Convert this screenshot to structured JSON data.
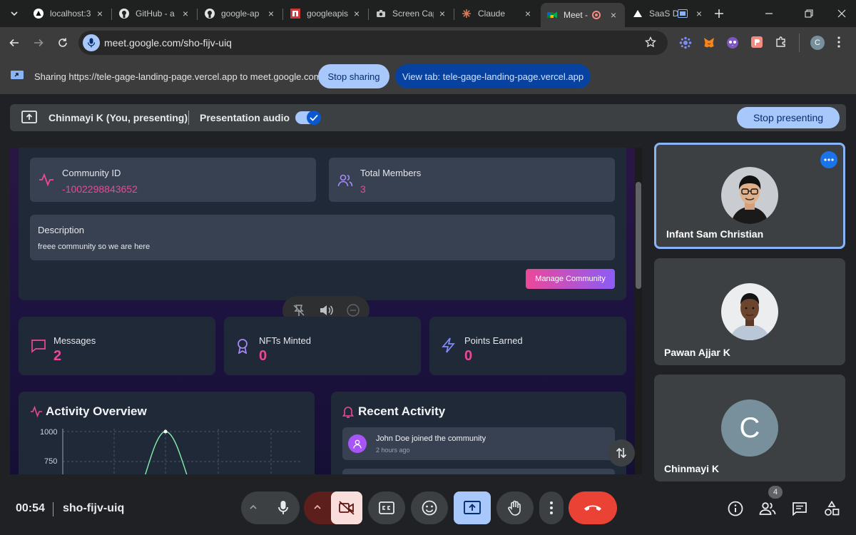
{
  "browser": {
    "tabs": [
      {
        "title": "localhost:3"
      },
      {
        "title": "GitHub - a"
      },
      {
        "title": "google-ap"
      },
      {
        "title": "googleapis"
      },
      {
        "title": "Screen Cap"
      },
      {
        "title": "Claude"
      },
      {
        "title": "Meet -"
      },
      {
        "title": "SaaS D"
      }
    ],
    "url": "meet.google.com/sho-fijv-uiq",
    "profile_initial": "C"
  },
  "sharing": {
    "message": "Sharing https://tele-gage-landing-page.vercel.app to meet.google.com",
    "stop_label": "Stop sharing",
    "view_tab_label": "View tab: tele-gage-landing-page.vercel.app"
  },
  "presenting": {
    "name": "Chinmayi K (You, presenting)",
    "audio_label": "Presentation audio",
    "stop_label": "Stop presenting"
  },
  "dashboard": {
    "community_id_label": "Community ID",
    "community_id": "-1002298843652",
    "total_members_label": "Total Members",
    "total_members": "3",
    "description_label": "Description",
    "description": "freee community so we are here",
    "manage_label": "Manage Community",
    "stats": [
      {
        "label": "Messages",
        "value": "2"
      },
      {
        "label": "NFTs Minted",
        "value": "0"
      },
      {
        "label": "Points Earned",
        "value": "0"
      }
    ],
    "activity_overview_title": "Activity Overview",
    "chart_ticks": [
      "1000",
      "750"
    ],
    "recent_activity_title": "Recent Activity",
    "recent": [
      {
        "text": "John Doe joined the community",
        "time": "2 hours ago"
      }
    ]
  },
  "participants": [
    {
      "name": "Infant Sam Christian"
    },
    {
      "name": "Pawan Ajjar K"
    },
    {
      "name": "Chinmayi K",
      "initial": "C"
    }
  ],
  "meeting": {
    "time": "00:54",
    "code": "sho-fijv-uiq",
    "participant_count": "4"
  },
  "colors": {
    "accent": "#a8c7fa",
    "end_call": "#ea4335",
    "pink": "#ec4899"
  }
}
